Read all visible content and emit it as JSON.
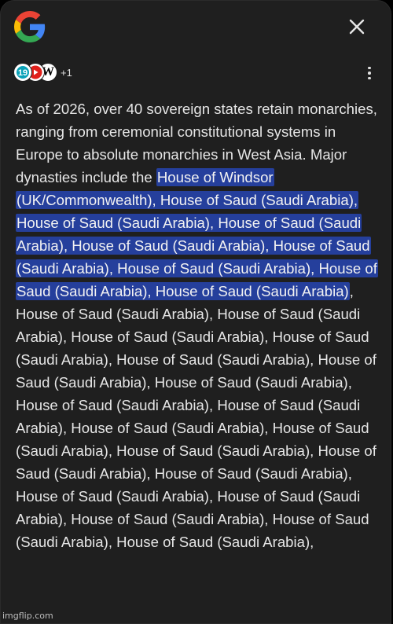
{
  "header": {
    "logo_icon": "google-g-icon",
    "close_icon": "close-icon"
  },
  "sources": {
    "icons": [
      "tv-channel-icon",
      "youtube-icon",
      "wikipedia-icon"
    ],
    "wikipedia_letter": "W",
    "more_count": "+1",
    "menu_icon": "more-vertical-icon"
  },
  "answer": {
    "intro": "As of 2026, over 40 sovereign states retain monarchies, ranging from ceremonial constitutional systems in Europe to absolute monarchies in West Asia. Major dynasties include the ",
    "highlighted": "House of Windsor (UK/Commonwealth), House of Saud (Saudi Arabia), House of Saud (Saudi Arabia), House of Saud (Saudi Arabia), House of Saud (Saudi Arabia), House of Saud (Saudi Arabia), House of Saud (Saudi Arabia), House of Saud (Saudi Arabia), House of Saud (Saudi Arabia)",
    "rest": ", House of Saud (Saudi Arabia), House of Saud (Saudi Arabia), House of Saud (Saudi Arabia), House of Saud (Saudi Arabia), House of Saud (Saudi Arabia), House of Saud (Saudi Arabia), House of Saud (Saudi Arabia), House of Saud (Saudi Arabia), House of Saud (Saudi Arabia), House of Saud (Saudi Arabia), House of Saud (Saudi Arabia), House of Saud (Saudi Arabia), House of Saud (Saudi Arabia), House of Saud (Saudi Arabia), House of Saud (Saudi Arabia), House of Saud (Saudi Arabia), House of Saud (Saudi Arabia), House of Saud (Saudi Arabia), House of Saud (Saudi Arabia),"
  },
  "watermark": "imgflip.com",
  "colors": {
    "background": "#1f1f1f",
    "text": "#e6e6e6",
    "highlight": "#253f9c",
    "google_blue": "#4285F4",
    "google_red": "#EA4335",
    "google_yellow": "#FBBC05",
    "google_green": "#34A853"
  }
}
